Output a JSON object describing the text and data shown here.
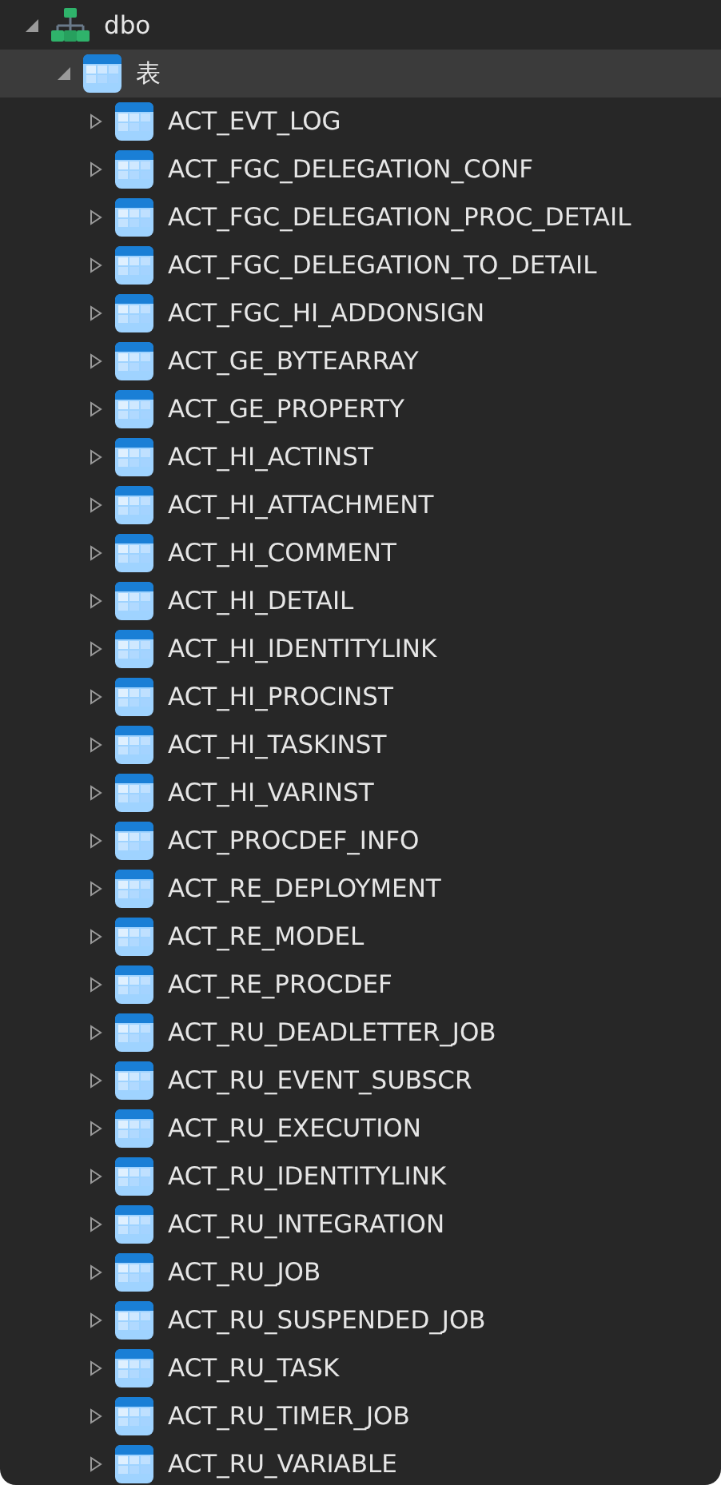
{
  "tree": [
    {
      "label": "dbo",
      "kind": "schema",
      "expanded": true,
      "selected": false,
      "children": [
        {
          "label": "表",
          "kind": "folder",
          "expanded": true,
          "selected": true,
          "children": [
            {
              "label": "ACT_EVT_LOG",
              "kind": "table",
              "expanded": false,
              "selected": false
            },
            {
              "label": "ACT_FGC_DELEGATION_CONF",
              "kind": "table",
              "expanded": false,
              "selected": false
            },
            {
              "label": "ACT_FGC_DELEGATION_PROC_DETAIL",
              "kind": "table",
              "expanded": false,
              "selected": false
            },
            {
              "label": "ACT_FGC_DELEGATION_TO_DETAIL",
              "kind": "table",
              "expanded": false,
              "selected": false
            },
            {
              "label": "ACT_FGC_HI_ADDONSIGN",
              "kind": "table",
              "expanded": false,
              "selected": false
            },
            {
              "label": "ACT_GE_BYTEARRAY",
              "kind": "table",
              "expanded": false,
              "selected": false
            },
            {
              "label": "ACT_GE_PROPERTY",
              "kind": "table",
              "expanded": false,
              "selected": false
            },
            {
              "label": "ACT_HI_ACTINST",
              "kind": "table",
              "expanded": false,
              "selected": false
            },
            {
              "label": "ACT_HI_ATTACHMENT",
              "kind": "table",
              "expanded": false,
              "selected": false
            },
            {
              "label": "ACT_HI_COMMENT",
              "kind": "table",
              "expanded": false,
              "selected": false
            },
            {
              "label": "ACT_HI_DETAIL",
              "kind": "table",
              "expanded": false,
              "selected": false
            },
            {
              "label": "ACT_HI_IDENTITYLINK",
              "kind": "table",
              "expanded": false,
              "selected": false
            },
            {
              "label": "ACT_HI_PROCINST",
              "kind": "table",
              "expanded": false,
              "selected": false
            },
            {
              "label": "ACT_HI_TASKINST",
              "kind": "table",
              "expanded": false,
              "selected": false
            },
            {
              "label": "ACT_HI_VARINST",
              "kind": "table",
              "expanded": false,
              "selected": false
            },
            {
              "label": "ACT_PROCDEF_INFO",
              "kind": "table",
              "expanded": false,
              "selected": false
            },
            {
              "label": "ACT_RE_DEPLOYMENT",
              "kind": "table",
              "expanded": false,
              "selected": false
            },
            {
              "label": "ACT_RE_MODEL",
              "kind": "table",
              "expanded": false,
              "selected": false
            },
            {
              "label": "ACT_RE_PROCDEF",
              "kind": "table",
              "expanded": false,
              "selected": false
            },
            {
              "label": "ACT_RU_DEADLETTER_JOB",
              "kind": "table",
              "expanded": false,
              "selected": false
            },
            {
              "label": "ACT_RU_EVENT_SUBSCR",
              "kind": "table",
              "expanded": false,
              "selected": false
            },
            {
              "label": "ACT_RU_EXECUTION",
              "kind": "table",
              "expanded": false,
              "selected": false
            },
            {
              "label": "ACT_RU_IDENTITYLINK",
              "kind": "table",
              "expanded": false,
              "selected": false
            },
            {
              "label": "ACT_RU_INTEGRATION",
              "kind": "table",
              "expanded": false,
              "selected": false
            },
            {
              "label": "ACT_RU_JOB",
              "kind": "table",
              "expanded": false,
              "selected": false
            },
            {
              "label": "ACT_RU_SUSPENDED_JOB",
              "kind": "table",
              "expanded": false,
              "selected": false
            },
            {
              "label": "ACT_RU_TASK",
              "kind": "table",
              "expanded": false,
              "selected": false
            },
            {
              "label": "ACT_RU_TIMER_JOB",
              "kind": "table",
              "expanded": false,
              "selected": false
            },
            {
              "label": "ACT_RU_VARIABLE",
              "kind": "table",
              "expanded": false,
              "selected": false
            }
          ]
        }
      ]
    }
  ]
}
